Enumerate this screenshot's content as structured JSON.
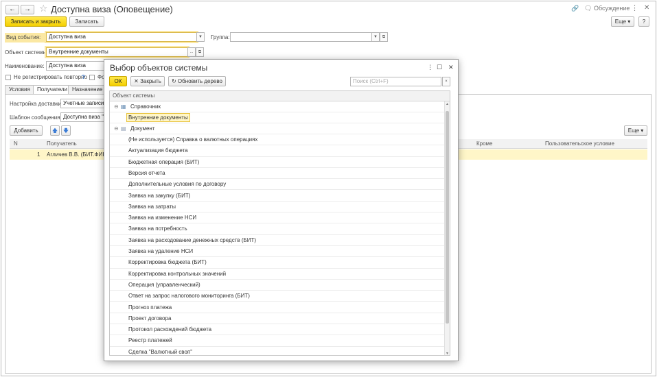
{
  "window": {
    "title": "Доступна виза (Оповещение)",
    "discussion": "Обсуждение",
    "more_icon": "⋮",
    "close_icon": "✕"
  },
  "toolbar": {
    "save_close": "Записать и закрыть",
    "save": "Записать",
    "more": "Еще",
    "help": "?"
  },
  "form": {
    "event_type_label": "Вид события:",
    "event_type_value": "Доступна виза",
    "group_label": "Группа:",
    "group_value": "",
    "system_object_label": "Объект системы:",
    "system_object_value": "Внутренние документы",
    "name_label": "Наименование:",
    "name_value": "Доступна виза",
    "no_repeat_label": "Не регистрировать повторно",
    "help_mark": "?",
    "second_checkbox_label": "Фо"
  },
  "tabs": [
    "Условия",
    "Получатели",
    "Назначение о"
  ],
  "recipients": {
    "delivery_label": "Настройка доставки:",
    "delivery_value": "Учетные записи эл",
    "template_label": "Шаблон сообщения:",
    "template_value": "Доступна виза \"Вн",
    "add_button": "Добавить",
    "more_button": "Еще",
    "columns": [
      "N",
      "Получатель",
      "Кроме",
      "Пользовательское условие"
    ],
    "rows": [
      {
        "n": "1",
        "recipient": "Агличев В.В. (БИТ.ФИНА"
      }
    ]
  },
  "dialog": {
    "title": "Выбор объектов системы",
    "ok": "ОК",
    "close": "Закрыть",
    "refresh": "Обновить дерево",
    "search_placeholder": "Поиск (Ctrl+F)",
    "column": "Объект системы",
    "group1": "Справочник",
    "selected_item": "Внутренние документы",
    "group2": "Документ",
    "items": [
      "(Не используется) Справка о валютных операциях",
      "Актуализация бюджета",
      "Бюджетная операция (БИТ)",
      "Версия отчета",
      "Дополнительные условия по договору",
      "Заявка на закупку (БИТ)",
      "Заявка на затраты",
      "Заявка на изменение НСИ",
      "Заявка на потребность",
      "Заявка на расходование денежных средств (БИТ)",
      "Заявка на удаление НСИ",
      "Корректировка бюджета (БИТ)",
      "Корректировка контрольных значений",
      "Операция (управленческий)",
      "Ответ на запрос налогового мониторинга (БИТ)",
      "Прогноз платежа",
      "Проект договора",
      "Протокол расхождений бюджета",
      "Реестр платежей",
      "Сделка \"Валютный своп\""
    ]
  },
  "colors": {
    "accent_yellow": "#f4cf00",
    "selected_row": "#fff6c8",
    "highlight_border": "#fbe8a3"
  }
}
